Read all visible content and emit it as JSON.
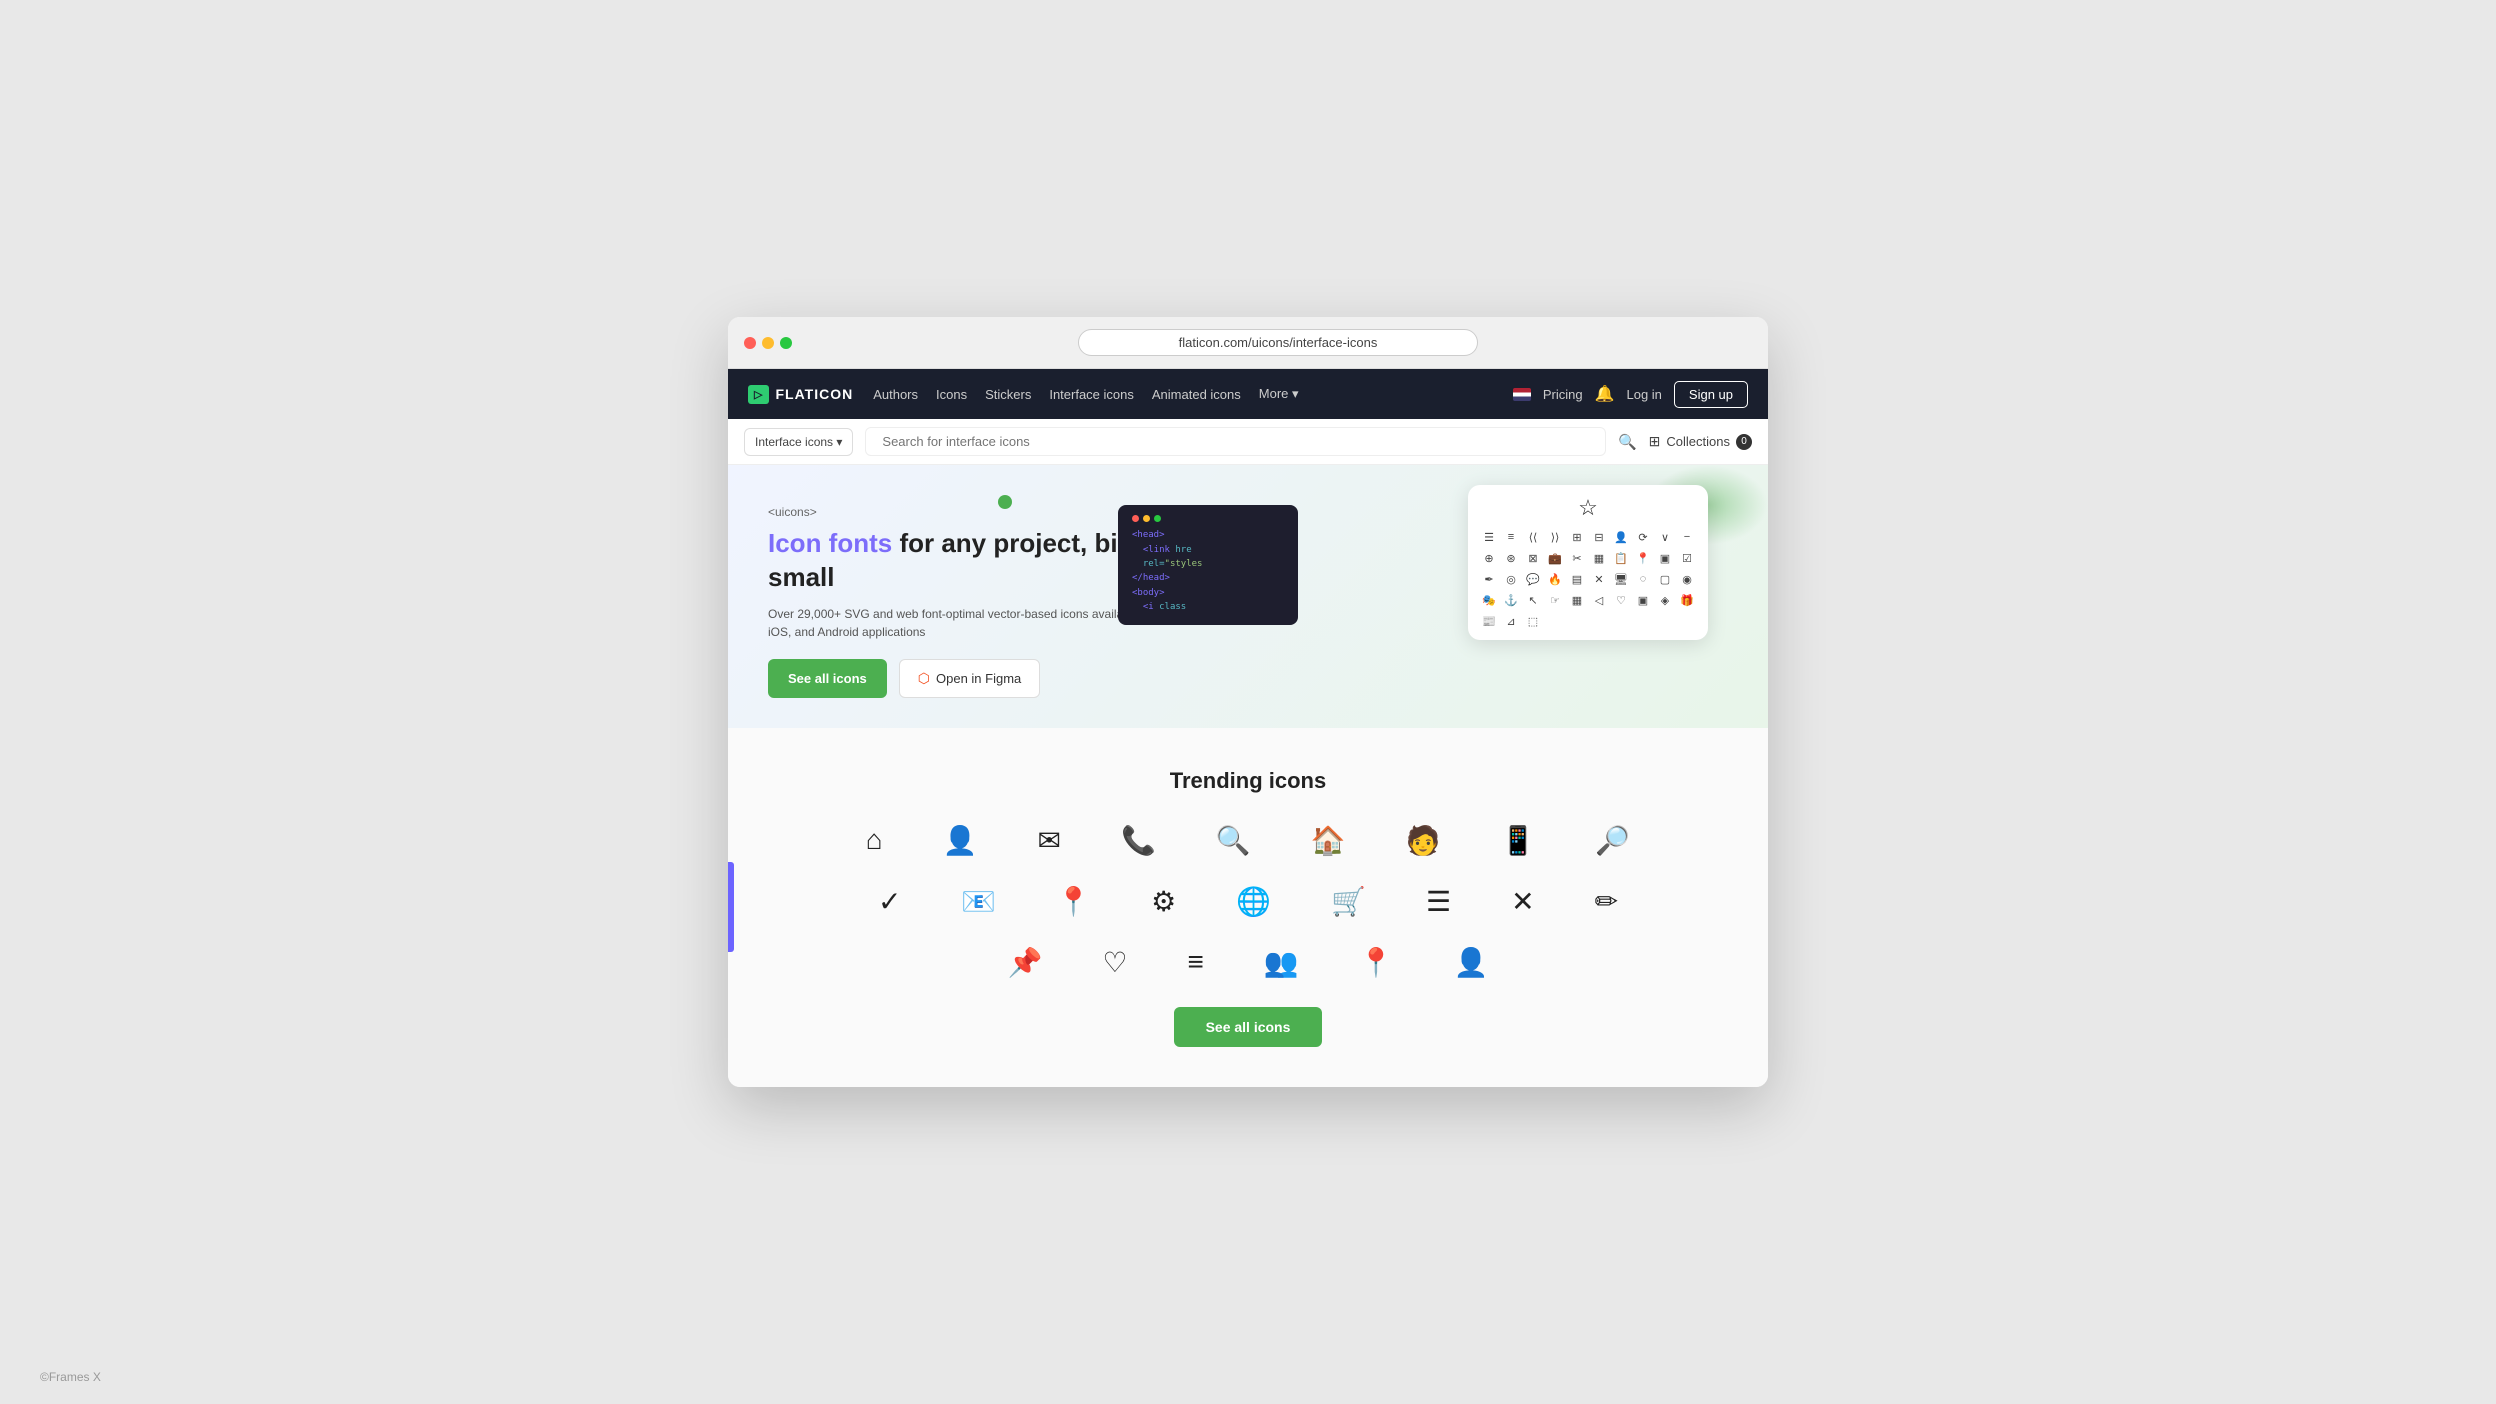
{
  "browser": {
    "url": "flaticon.com/uicons/interface-icons"
  },
  "nav": {
    "logo": "FLATICON",
    "logo_icon": "▷",
    "links": [
      "Authors",
      "Icons",
      "Stickers",
      "Interface icons",
      "Animated icons",
      "More ▾"
    ],
    "pricing": "Pricing",
    "login": "Log in",
    "signup": "Sign up"
  },
  "toolbar": {
    "filter_label": "Interface icons ▾",
    "search_placeholder": "Search for interface icons",
    "collections_label": "Collections",
    "collections_count": "0"
  },
  "hero": {
    "brand": "<uicons>",
    "title_colored": "Icon fonts",
    "title_rest": " for any project, big or small",
    "description": "Over 29,000+ SVG and web font-optimal vector-based icons available for web, iOS, and Android applications",
    "btn_see_all": "See all icons",
    "btn_figma": "Open in Figma"
  },
  "trending": {
    "title": "Trending icons",
    "see_all_label": "See all icons",
    "icons_row1": [
      "⌂",
      "👤",
      "✉",
      "📞",
      "🔍",
      "🏠",
      "🧑",
      "📱",
      "🔎"
    ],
    "icons_row2": [
      "✓",
      "✉",
      "📍",
      "⚙",
      "🌐",
      "🛒",
      "☰",
      "✕",
      "✏"
    ],
    "icons_row3": [
      "📍",
      "♡",
      "≡",
      "👥",
      "📌",
      "👤"
    ]
  },
  "footer": {
    "copyright": "©Frames X"
  }
}
